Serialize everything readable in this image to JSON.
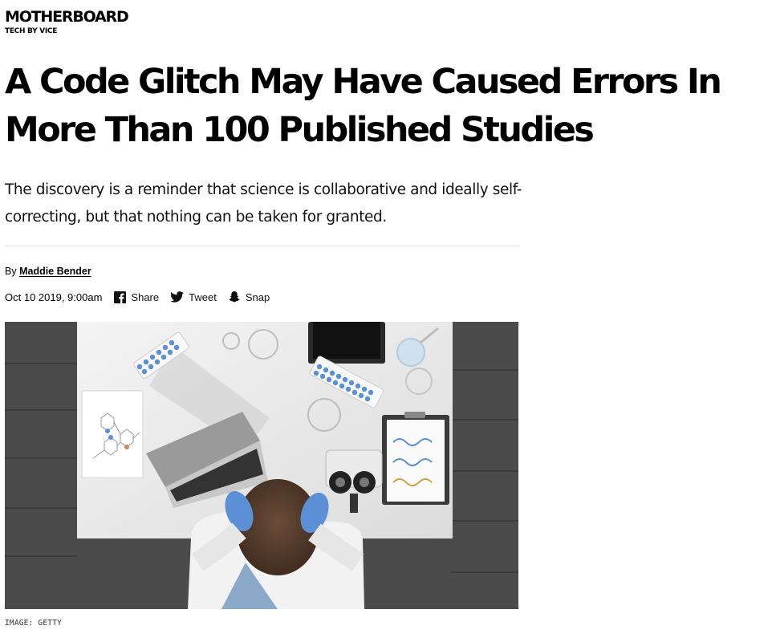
{
  "brand": {
    "name": "MOTHERBOARD",
    "tagline": "TECH BY VICE"
  },
  "article": {
    "headline_line1": "A Code Glitch May Have Caused Errors In",
    "headline_line2": "More Than 100 Published Studies",
    "dek": "The discovery is a reminder that science is collaborative and ideally self-correcting, but that nothing can be taken for granted.",
    "byline_prefix": "By",
    "author": "Maddie Bender",
    "date": "Oct 10 2019, 9:00am"
  },
  "share": [
    {
      "icon": "facebook-icon",
      "label": "Share"
    },
    {
      "icon": "twitter-icon",
      "label": "Tweet"
    },
    {
      "icon": "snapchat-icon",
      "label": "Snap"
    }
  ],
  "image": {
    "credit": "IMAGE: GETTY"
  },
  "colors": {
    "text": "#000000",
    "rule": "#e1e1e1",
    "floor": "#4b4b4c",
    "desk": "#e9e9e9",
    "gloves": "#5b8fd6"
  }
}
